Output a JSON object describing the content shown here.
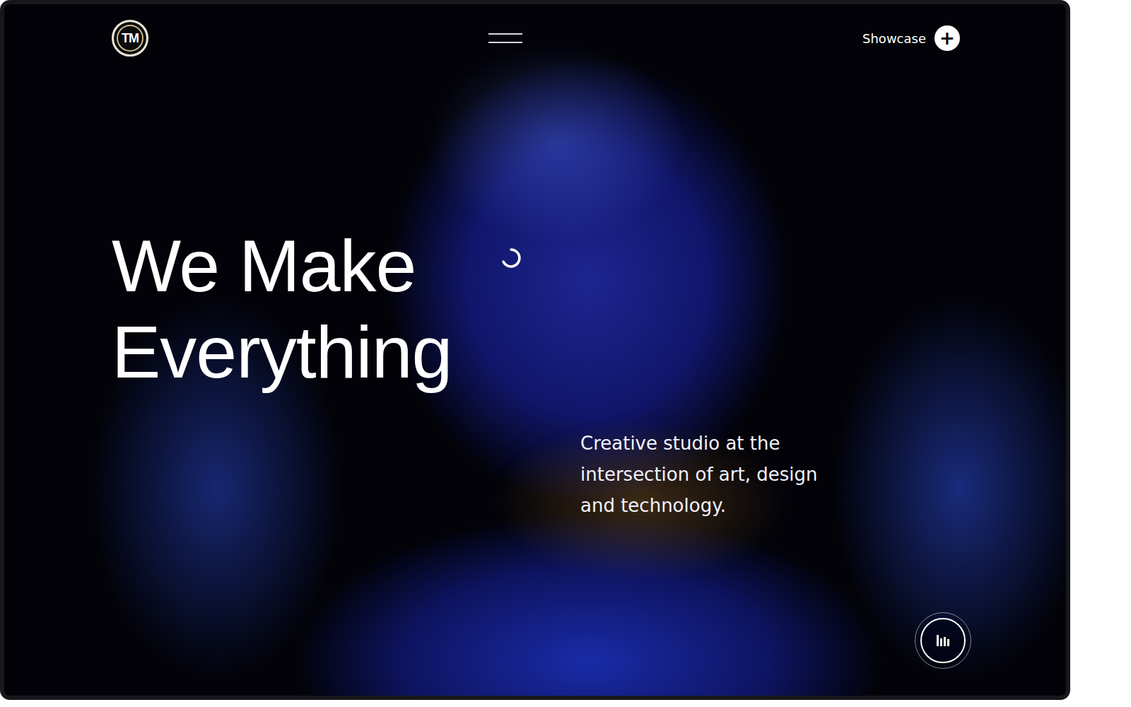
{
  "logo": {
    "text": "TM"
  },
  "showcase": {
    "label": "Showcase",
    "icon": "+"
  },
  "hero": {
    "title_lines": [
      "We Make",
      "Everything"
    ],
    "subtitle_lines": [
      "Creative studio at the",
      "intersection of art, design",
      "and technology."
    ]
  }
}
